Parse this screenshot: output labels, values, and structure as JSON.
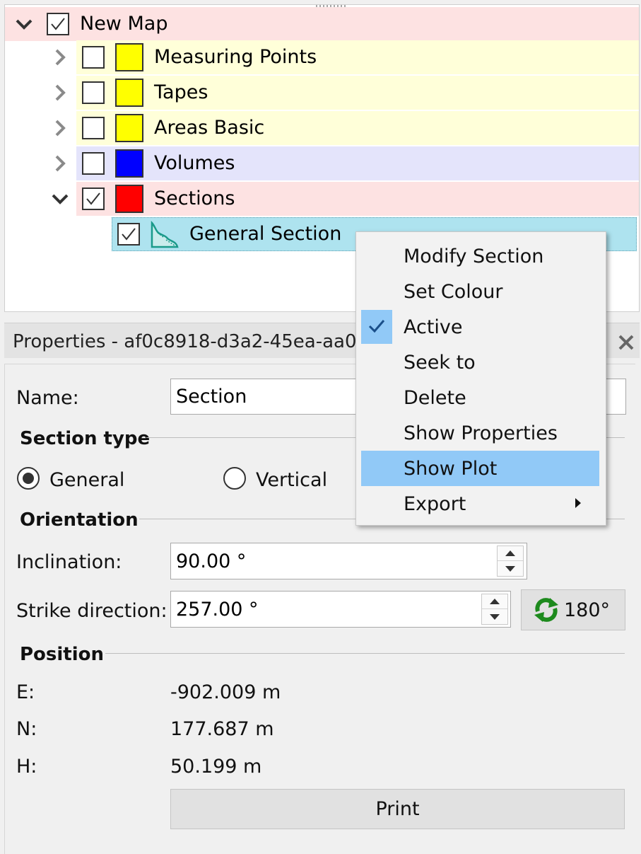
{
  "tree": {
    "root": {
      "label": "New Map",
      "checked": true,
      "expanded": true,
      "row_color": "#fde2e2"
    },
    "layers": [
      {
        "label": "Measuring Points",
        "checked": false,
        "expanded": false,
        "swatch_color": "#ffff00",
        "row_color": "#ffffd9"
      },
      {
        "label": "Tapes",
        "checked": false,
        "expanded": false,
        "swatch_color": "#ffff00",
        "row_color": "#ffffd9"
      },
      {
        "label": "Areas Basic",
        "checked": false,
        "expanded": false,
        "swatch_color": "#ffff00",
        "row_color": "#ffffd9"
      },
      {
        "label": "Volumes",
        "checked": false,
        "expanded": false,
        "swatch_color": "#0000ff",
        "row_color": "#e4e4fb"
      },
      {
        "label": "Sections",
        "checked": true,
        "expanded": true,
        "swatch_color": "#ff0000",
        "row_color": "#fde2e2"
      }
    ],
    "selected_item": {
      "label": "General Section",
      "checked": true,
      "icon": "general-section-icon",
      "row_color": "#aee3ef"
    }
  },
  "properties": {
    "title": "Properties - af0c8918-d3a2-45ea-aa0",
    "name_label": "Name:",
    "name_value": "Section",
    "section_type": {
      "title": "Section type",
      "options": [
        "General",
        "Vertical"
      ],
      "selected": "General"
    },
    "orientation": {
      "title": "Orientation",
      "inclination_label": "Inclination:",
      "inclination_value": "90.00 °",
      "strike_label": "Strike direction:",
      "strike_value": "257.00 °",
      "flip_button_label": "180°"
    },
    "position": {
      "title": "Position",
      "e_label": "E:",
      "e_value": "-902.009 m",
      "n_label": "N:",
      "n_value": "177.687 m",
      "h_label": "H:",
      "h_value": "50.199 m"
    },
    "print_button_label": "Print"
  },
  "context_menu": {
    "items": [
      {
        "label": "Modify Section"
      },
      {
        "label": "Set Colour"
      },
      {
        "label": "Active",
        "checked": true
      },
      {
        "label": "Seek to"
      },
      {
        "label": "Delete"
      },
      {
        "label": "Show Properties"
      },
      {
        "label": "Show Plot",
        "highlighted": true
      },
      {
        "label": "Export",
        "submenu": true
      }
    ],
    "highlight_color": "#91c9f7"
  }
}
